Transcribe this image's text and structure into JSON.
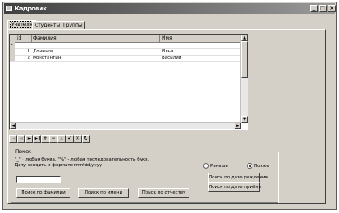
{
  "window": {
    "title": "Кадровик"
  },
  "titlebar_buttons": [
    "_",
    "□",
    "×"
  ],
  "tabs": [
    {
      "label": "Учителя",
      "active": true
    },
    {
      "label": "Студенты",
      "active": false
    },
    {
      "label": "Группы",
      "active": false
    }
  ],
  "grid": {
    "columns": [
      "id",
      "Фамилия",
      "Имя"
    ],
    "rows": [
      {
        "indicator": "►",
        "id": "",
        "surname": "",
        "name": ""
      },
      {
        "indicator": "",
        "id": "1",
        "surname": "Доменов",
        "name": "Илья"
      },
      {
        "indicator": "",
        "id": "2",
        "surname": "Константин",
        "name": "Василий"
      }
    ]
  },
  "navigator": {
    "buttons": [
      {
        "name": "first",
        "glyph": "|◄",
        "enabled": false
      },
      {
        "name": "prior",
        "glyph": "◄",
        "enabled": false
      },
      {
        "name": "next",
        "glyph": "►",
        "enabled": true
      },
      {
        "name": "last",
        "glyph": "►|",
        "enabled": true
      },
      {
        "name": "insert",
        "glyph": "+",
        "enabled": true
      },
      {
        "name": "delete",
        "glyph": "−",
        "enabled": true
      },
      {
        "name": "edit",
        "glyph": "▲",
        "enabled": false
      },
      {
        "name": "post",
        "glyph": "✔",
        "enabled": true
      },
      {
        "name": "cancel",
        "glyph": "✕",
        "enabled": true
      },
      {
        "name": "refresh",
        "glyph": "↻",
        "enabled": true
      }
    ]
  },
  "search": {
    "title": "Поиск",
    "hint1": "\"_\" - любая буква, \"%\" - любая последовательность букв.",
    "hint2": "Дату вводить в формате mm/dd/yyyy",
    "input_value": "",
    "btn_surname": "Поиск по фамилии",
    "btn_name": "Поиск по имени",
    "btn_patronymic": "Поиск по отчеству",
    "radio_earlier": "Раньше",
    "radio_later": "Позже",
    "radio_selected": "later",
    "btn_birth_date": "Поиск по дате рождения",
    "btn_hire_date": "Поиск по дате приёма"
  }
}
